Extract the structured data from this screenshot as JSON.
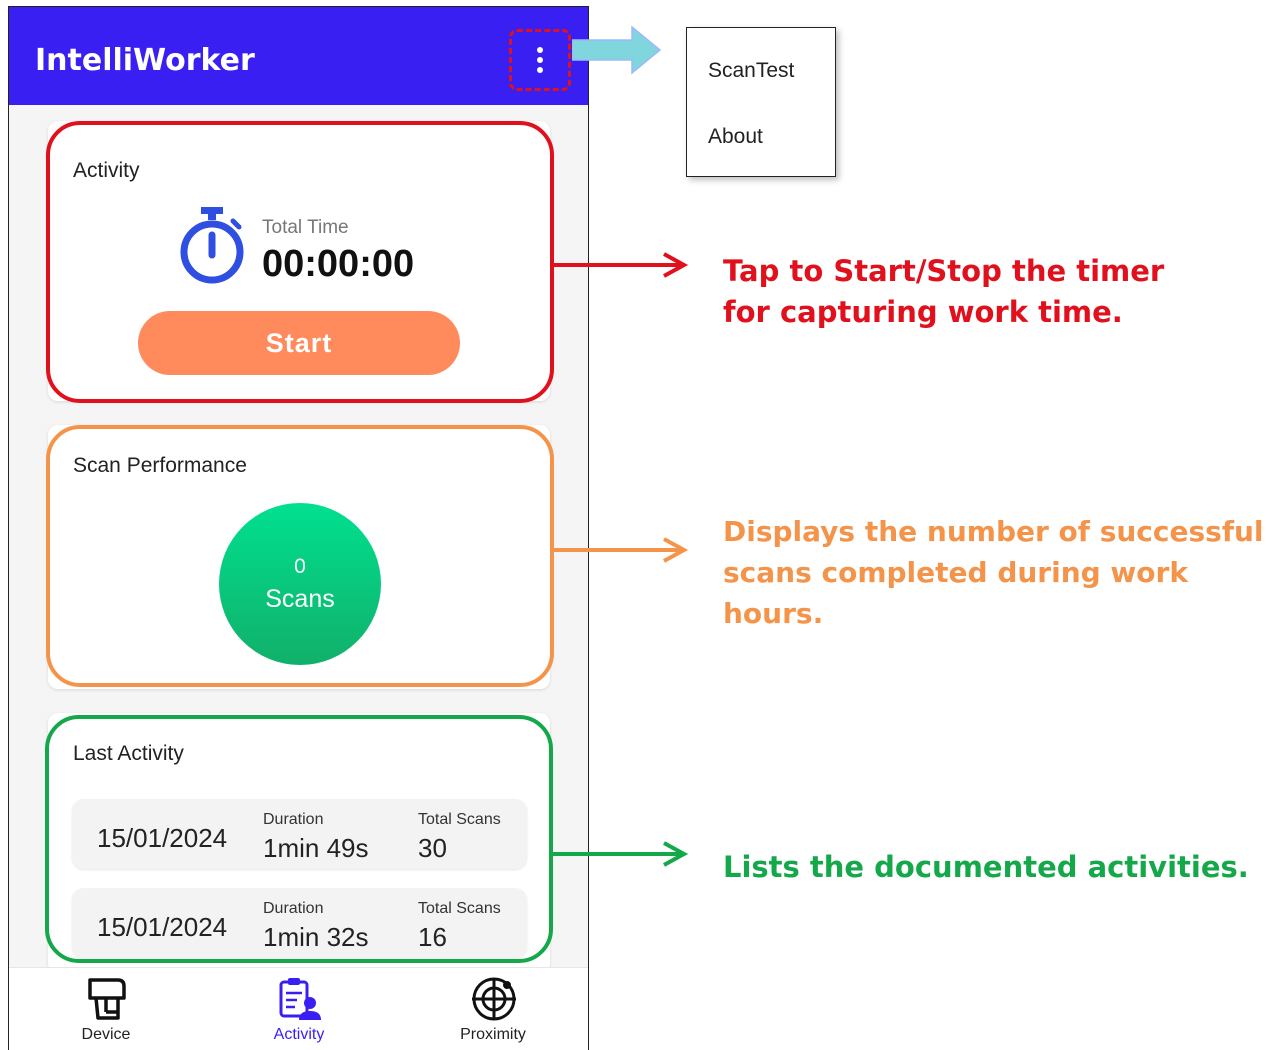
{
  "app": {
    "title": "IntelliWorker"
  },
  "menu": {
    "items": [
      "ScanTest",
      "About"
    ]
  },
  "activity_card": {
    "title": "Activity",
    "total_time_label": "Total Time",
    "total_time_value": "00:00:00",
    "start_label": "Start"
  },
  "scan_card": {
    "title": "Scan Performance",
    "count": "0",
    "unit": "Scans"
  },
  "last_activity": {
    "title": "Last Activity",
    "duration_label": "Duration",
    "scans_label": "Total Scans",
    "rows": [
      {
        "date": "15/01/2024",
        "duration": "1min 49s",
        "scans": "30"
      },
      {
        "date": "15/01/2024",
        "duration": "1min 32s",
        "scans": "16"
      }
    ]
  },
  "nav": {
    "device": "Device",
    "activity": "Activity",
    "proximity": "Proximity"
  },
  "annotations": {
    "timer_line1": "Tap to Start/Stop the timer",
    "timer_line2": "for capturing work time.",
    "scans_line1": "Displays the number of successful",
    "scans_line2": "scans completed during work hours.",
    "list_line1": "Lists the documented activities."
  },
  "colors": {
    "appbar": "#3a1ff2",
    "start_button": "#ff8a5c",
    "highlight_red": "#e0101c",
    "highlight_orange": "#f4944a",
    "highlight_green": "#14a84a"
  }
}
